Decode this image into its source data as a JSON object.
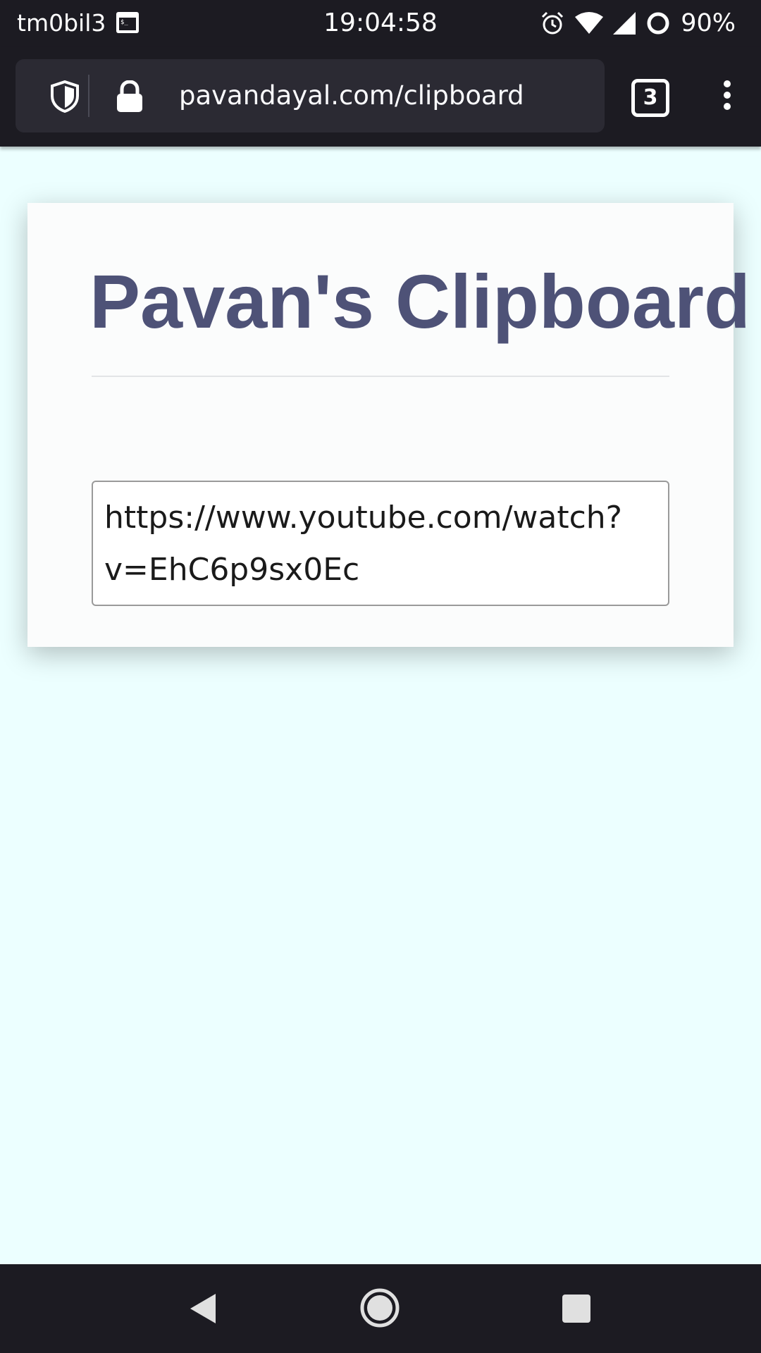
{
  "status_bar": {
    "carrier": "tm0bil3",
    "time": "19:04:58",
    "battery": "90%",
    "icons": [
      "terminal-icon",
      "alarm-icon",
      "wifi-icon",
      "cell-signal-icon",
      "battery-icon"
    ]
  },
  "browser": {
    "url": "pavandayal.com/clipboard",
    "tab_count": "3",
    "icons": [
      "shield-icon",
      "lock-icon",
      "tabs-icon",
      "kebab-menu-icon"
    ]
  },
  "page": {
    "title": "Pavan's Clipboard",
    "clipboard_text": "https://www.youtube.com/watch?v=EhC6p9sx0Ec"
  },
  "nav": {
    "icons": [
      "back-icon",
      "home-icon",
      "recents-icon"
    ]
  },
  "colors": {
    "page_background": "#ecffff",
    "title": "#4e5277",
    "system_bars": "#1c1b22",
    "url_bar": "#2b2a33"
  }
}
